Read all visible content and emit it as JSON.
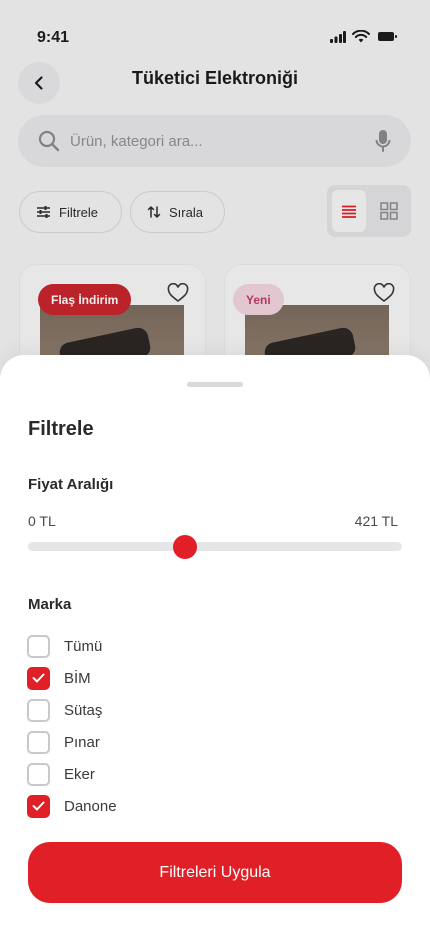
{
  "status_bar": {
    "time": "9:41"
  },
  "header": {
    "title": "Tüketici Elektroniği"
  },
  "search": {
    "placeholder": "Ürün, kategori ara..."
  },
  "toolbar": {
    "filter_label": "Filtrele",
    "sort_label": "Sırala",
    "active_view": "list"
  },
  "products": [
    {
      "badge": "Flaş İndirim",
      "badge_color": "#c8232b"
    },
    {
      "badge": "Yeni",
      "badge_color": "#f2d4df"
    }
  ],
  "filter_sheet": {
    "title": "Filtrele",
    "price": {
      "label": "Fiyat Aralığı",
      "min_label": "0 TL",
      "max_label": "421 TL",
      "min": 0,
      "max": 421,
      "value_fraction": 0.42
    },
    "brand": {
      "label": "Marka",
      "options": [
        {
          "name": "Tümü",
          "checked": false
        },
        {
          "name": "BİM",
          "checked": true
        },
        {
          "name": "Sütaş",
          "checked": false
        },
        {
          "name": "Pınar",
          "checked": false
        },
        {
          "name": "Eker",
          "checked": false
        },
        {
          "name": "Danone",
          "checked": true
        }
      ]
    },
    "apply_label": "Filtreleri Uygula"
  },
  "colors": {
    "accent": "#e02026",
    "background": "#f3f3f4",
    "sheet": "#ffffff"
  }
}
